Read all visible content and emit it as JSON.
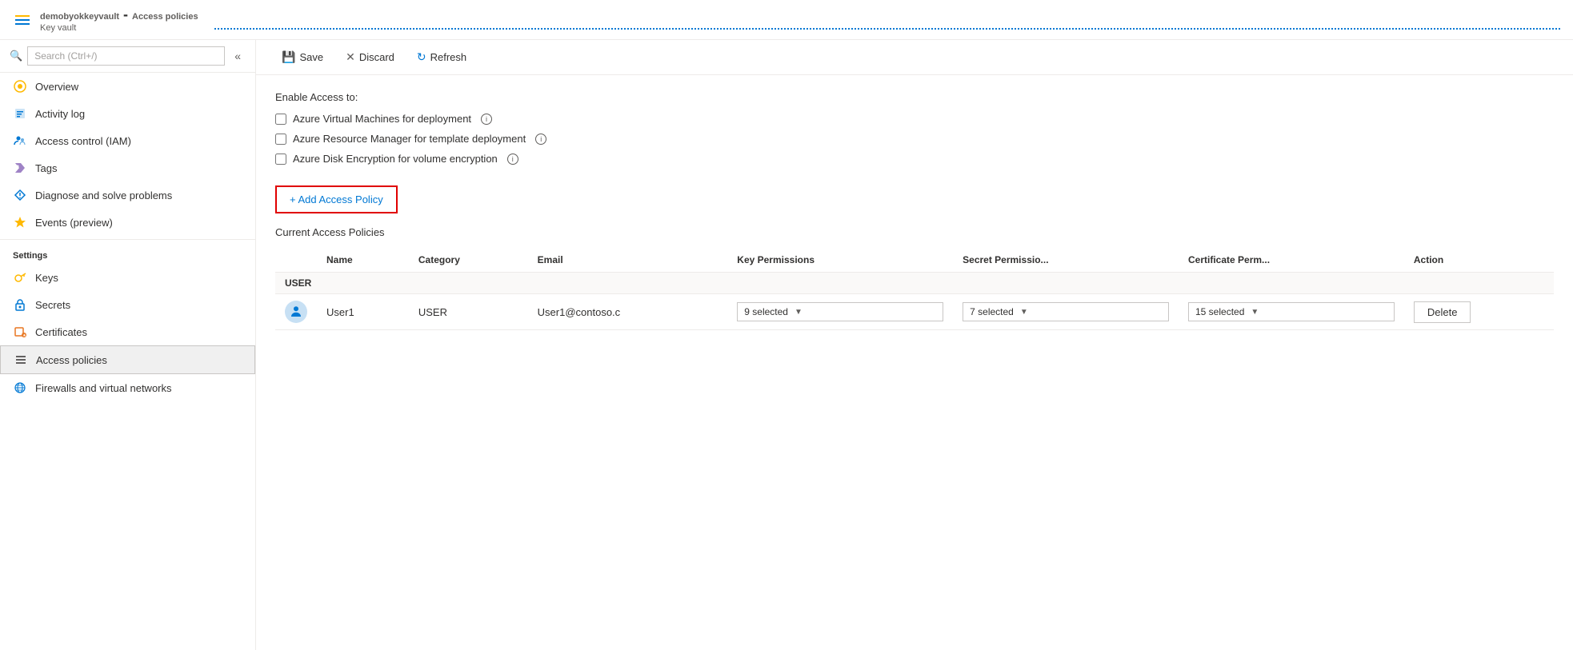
{
  "header": {
    "vault_name": "demobyokkeyvault",
    "section": "Access policies",
    "subtitle": "Key vault"
  },
  "toolbar": {
    "save_label": "Save",
    "discard_label": "Discard",
    "refresh_label": "Refresh"
  },
  "sidebar": {
    "search_placeholder": "Search (Ctrl+/)",
    "items": [
      {
        "id": "overview",
        "label": "Overview",
        "icon": "overview"
      },
      {
        "id": "activity-log",
        "label": "Activity log",
        "icon": "activity"
      },
      {
        "id": "access-control",
        "label": "Access control (IAM)",
        "icon": "iam"
      },
      {
        "id": "tags",
        "label": "Tags",
        "icon": "tags"
      },
      {
        "id": "diagnose",
        "label": "Diagnose and solve problems",
        "icon": "diagnose"
      },
      {
        "id": "events",
        "label": "Events (preview)",
        "icon": "events"
      }
    ],
    "settings_label": "Settings",
    "settings_items": [
      {
        "id": "keys",
        "label": "Keys",
        "icon": "keys"
      },
      {
        "id": "secrets",
        "label": "Secrets",
        "icon": "secrets"
      },
      {
        "id": "certificates",
        "label": "Certificates",
        "icon": "certificates"
      },
      {
        "id": "access-policies",
        "label": "Access policies",
        "icon": "access-policies",
        "active": true
      },
      {
        "id": "firewalls",
        "label": "Firewalls and virtual networks",
        "icon": "firewalls"
      }
    ]
  },
  "content": {
    "enable_access_label": "Enable Access to:",
    "checkboxes": [
      {
        "id": "vm",
        "label": "Azure Virtual Machines for deployment",
        "checked": false
      },
      {
        "id": "arm",
        "label": "Azure Resource Manager for template deployment",
        "checked": false
      },
      {
        "id": "disk",
        "label": "Azure Disk Encryption for volume encryption",
        "checked": false
      }
    ],
    "add_policy_label": "+ Add Access Policy",
    "current_policies_label": "Current Access Policies",
    "table_headers": {
      "name": "Name",
      "category": "Category",
      "email": "Email",
      "key_permissions": "Key Permissions",
      "secret_permissions": "Secret Permissio...",
      "cert_permissions": "Certificate Perm...",
      "action": "Action"
    },
    "group_label": "USER",
    "users": [
      {
        "name": "User1",
        "category": "USER",
        "email": "User1@contoso.c",
        "key_permissions": "9 selected",
        "secret_permissions": "7 selected",
        "cert_permissions": "15 selected",
        "action": "Delete"
      }
    ]
  }
}
